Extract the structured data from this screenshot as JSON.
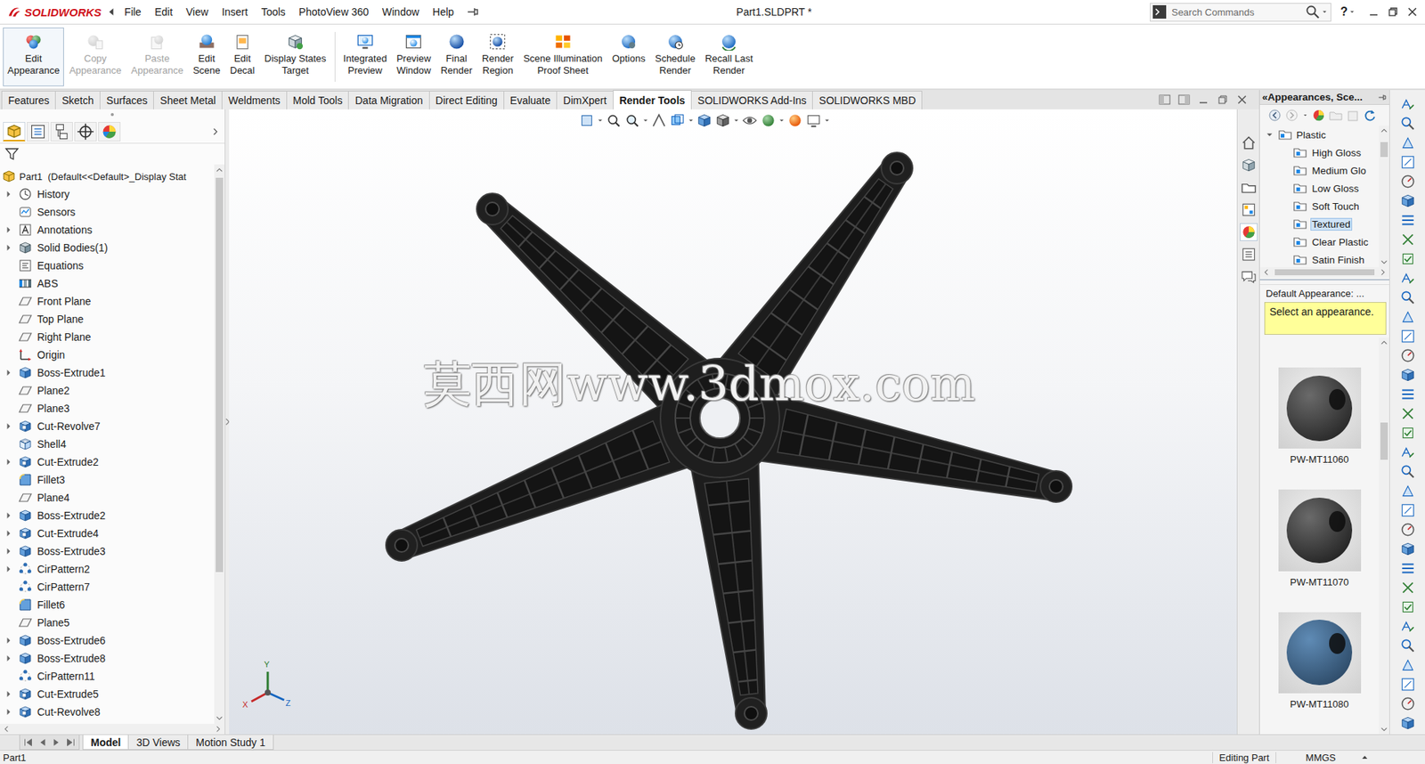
{
  "title_bar": {
    "logo": "SOLIDWORKS",
    "menu": [
      "File",
      "Edit",
      "View",
      "Insert",
      "Tools",
      "PhotoView 360",
      "Window",
      "Help"
    ],
    "title": "Part1.SLDPRT *",
    "search": {
      "placeholder": "Search Commands"
    },
    "help": "?"
  },
  "ribbon": {
    "buttons": [
      {
        "lines": [
          "Edit",
          "Appearance"
        ],
        "disabled": false,
        "selected": true
      },
      {
        "lines": [
          "Copy",
          "Appearance"
        ],
        "disabled": true,
        "selected": false
      },
      {
        "lines": [
          "Paste",
          "Appearance"
        ],
        "disabled": true,
        "selected": false
      },
      {
        "lines": [
          "Edit",
          "Scene"
        ],
        "disabled": false,
        "selected": false
      },
      {
        "lines": [
          "Edit",
          "Decal"
        ],
        "disabled": false,
        "selected": false
      },
      {
        "lines": [
          "Display States",
          "Target"
        ],
        "disabled": false,
        "selected": false
      },
      {
        "lines": [
          "Integrated",
          "Preview"
        ],
        "disabled": false,
        "selected": false
      },
      {
        "lines": [
          "Preview",
          "Window"
        ],
        "disabled": false,
        "selected": false
      },
      {
        "lines": [
          "Final",
          "Render"
        ],
        "disabled": false,
        "selected": false
      },
      {
        "lines": [
          "Render",
          "Region"
        ],
        "disabled": false,
        "selected": false
      },
      {
        "lines": [
          "Scene Illumination",
          "Proof Sheet"
        ],
        "disabled": false,
        "selected": false
      },
      {
        "lines": [
          "Options"
        ],
        "disabled": false,
        "selected": false
      },
      {
        "lines": [
          "Schedule",
          "Render"
        ],
        "disabled": false,
        "selected": false
      },
      {
        "lines": [
          "Recall Last",
          "Render"
        ],
        "disabled": false,
        "selected": false
      }
    ]
  },
  "tabs": [
    {
      "label": "Features",
      "selected": false
    },
    {
      "label": "Sketch",
      "selected": false
    },
    {
      "label": "Surfaces",
      "selected": false
    },
    {
      "label": "Sheet Metal",
      "selected": false
    },
    {
      "label": "Weldments",
      "selected": false
    },
    {
      "label": "Mold Tools",
      "selected": false
    },
    {
      "label": "Data Migration",
      "selected": false
    },
    {
      "label": "Direct Editing",
      "selected": false
    },
    {
      "label": "Evaluate",
      "selected": false
    },
    {
      "label": "DimXpert",
      "selected": false
    },
    {
      "label": "Render Tools",
      "selected": true
    },
    {
      "label": "SOLIDWORKS Add-Ins",
      "selected": false
    },
    {
      "label": "SOLIDWORKS MBD",
      "selected": false
    }
  ],
  "feature_tree": {
    "root": "Part1  (Default<<Default>_Display Stat",
    "items": [
      {
        "name": "History",
        "kind": "history",
        "expandable": true
      },
      {
        "name": "Sensors",
        "kind": "sensor",
        "expandable": false
      },
      {
        "name": "Annotations",
        "kind": "annotation",
        "expandable": true
      },
      {
        "name": "Solid Bodies(1)",
        "kind": "bodies",
        "expandable": true
      },
      {
        "name": "Equations",
        "kind": "equation",
        "expandable": false
      },
      {
        "name": "ABS",
        "kind": "material",
        "expandable": false
      },
      {
        "name": "Front Plane",
        "kind": "plane",
        "expandable": false
      },
      {
        "name": "Top Plane",
        "kind": "plane",
        "expandable": false
      },
      {
        "name": "Right Plane",
        "kind": "plane",
        "expandable": false
      },
      {
        "name": "Origin",
        "kind": "origin",
        "expandable": false
      },
      {
        "name": "Boss-Extrude1",
        "kind": "extrude",
        "expandable": true
      },
      {
        "name": "Plane2",
        "kind": "plane",
        "expandable": false
      },
      {
        "name": "Plane3",
        "kind": "plane",
        "expandable": false
      },
      {
        "name": "Cut-Revolve7",
        "kind": "cut",
        "expandable": true
      },
      {
        "name": "Shell4",
        "kind": "shell",
        "expandable": false
      },
      {
        "name": "Cut-Extrude2",
        "kind": "cut",
        "expandable": true
      },
      {
        "name": "Fillet3",
        "kind": "fillet",
        "expandable": false
      },
      {
        "name": "Plane4",
        "kind": "plane",
        "expandable": false
      },
      {
        "name": "Boss-Extrude2",
        "kind": "extrude",
        "expandable": true
      },
      {
        "name": "Cut-Extrude4",
        "kind": "cut",
        "expandable": true
      },
      {
        "name": "Boss-Extrude3",
        "kind": "extrude",
        "expandable": true
      },
      {
        "name": "CirPattern2",
        "kind": "pattern",
        "expandable": true
      },
      {
        "name": "CirPattern7",
        "kind": "pattern",
        "expandable": false
      },
      {
        "name": "Fillet6",
        "kind": "fillet",
        "expandable": false
      },
      {
        "name": "Plane5",
        "kind": "plane",
        "expandable": false
      },
      {
        "name": "Boss-Extrude6",
        "kind": "extrude",
        "expandable": true
      },
      {
        "name": "Boss-Extrude8",
        "kind": "extrude",
        "expandable": true
      },
      {
        "name": "CirPattern11",
        "kind": "pattern",
        "expandable": false
      },
      {
        "name": "Cut-Extrude5",
        "kind": "cut",
        "expandable": true
      },
      {
        "name": "Cut-Revolve8",
        "kind": "cut",
        "expandable": true
      }
    ]
  },
  "viewport": {
    "watermark": "莫西网www.3dmox.com",
    "triad": {
      "x": "X",
      "y": "Y",
      "z": "Z"
    }
  },
  "appearances": {
    "collapse": "«",
    "title": "Appearances, Sce...",
    "tree": [
      {
        "name": "Plastic",
        "kind": "folder",
        "expanded": true,
        "selected": false
      },
      {
        "name": "High Gloss",
        "kind": "appearance",
        "expanded": false,
        "selected": false
      },
      {
        "name": "Medium Glo",
        "kind": "appearance",
        "expanded": false,
        "selected": false
      },
      {
        "name": "Low Gloss",
        "kind": "appearance",
        "expanded": false,
        "selected": false
      },
      {
        "name": "Soft Touch",
        "kind": "appearance",
        "expanded": false,
        "selected": false
      },
      {
        "name": "Textured",
        "kind": "appearance",
        "expanded": false,
        "selected": true
      },
      {
        "name": "Clear Plastic",
        "kind": "appearance",
        "expanded": false,
        "selected": false
      },
      {
        "name": "Satin Finish",
        "kind": "appearance",
        "expanded": false,
        "selected": false
      }
    ],
    "default_label": "Default Appearance: ...",
    "hint": "Select an appearance.",
    "swatches": [
      {
        "name": "PW-MT11060",
        "color": "#2a2a2a"
      },
      {
        "name": "PW-MT11070",
        "color": "#262626"
      },
      {
        "name": "PW-MT11080",
        "color": "#2f4d6b"
      }
    ]
  },
  "bottom_tabs": [
    {
      "label": "Model",
      "selected": true
    },
    {
      "label": "3D Views",
      "selected": false
    },
    {
      "label": "Motion Study 1",
      "selected": false
    }
  ],
  "status_bar": {
    "document": "Part1",
    "mode": "Editing Part",
    "units": "MMGS"
  }
}
